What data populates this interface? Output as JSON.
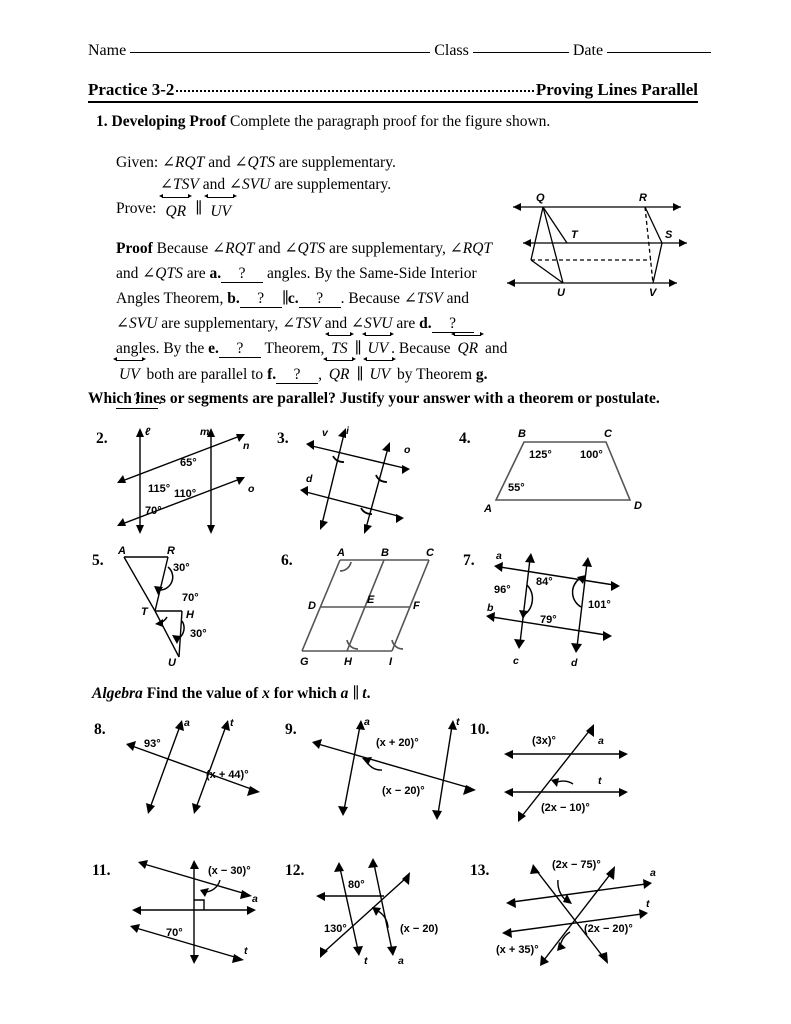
{
  "header": {
    "name_label": "Name",
    "class_label": "Class",
    "date_label": "Date",
    "practice_title": "Practice 3-2",
    "lesson_title": "Proving Lines Parallel"
  },
  "q1": {
    "number": "1.",
    "bold_lead": "Developing Proof",
    "instruction": "Complete the paragraph proof for the figure shown.",
    "given_label": "Given:",
    "given_1_a": "∠RQT",
    "given_1_and": "and",
    "given_1_b": "∠QTS",
    "given_1_tail": "are supplementary.",
    "given_2_a": "∠TSV",
    "given_2_and": "and",
    "given_2_b": "∠SVU",
    "given_2_tail": "are supplementary.",
    "prove_label": "Prove:",
    "prove_line1": "QR",
    "prove_parallel": "∥",
    "prove_line2": "UV",
    "proof_lead": "Proof",
    "p1": "Because",
    "p2": "∠RQT",
    "p3": "and",
    "p4": "∠QTS",
    "p5": "are supplementary,",
    "p6": "∠RQT",
    "p7": "and",
    "p8": "∠QTS",
    "p9": "are",
    "blank_a_label": "a.",
    "blank_a": "?",
    "p10": "angles. By the Same-Side Interior Angles Theorem,",
    "blank_b_label": "b.",
    "blank_b": "?",
    "parallel_sym": "∥",
    "blank_c_label": "c.",
    "blank_c": "?",
    "p11": ". Because",
    "p12": "∠TSV",
    "p13": "and",
    "p14": "∠SVU",
    "p15": "are supplementary,",
    "p16": "∠TSV",
    "p17": "and",
    "p18": "∠SVU",
    "p19": "are",
    "blank_d_label": "d.",
    "blank_d": "?",
    "p20": "angles. By the",
    "blank_e_label": "e.",
    "blank_e": "?",
    "p21": "Theorem,",
    "seg_ts": "TS",
    "seg_uv": "UV",
    "p22": ". Because",
    "seg_qr": "QR",
    "p23": "and",
    "seg_uv2": "UV",
    "p24": "both are parallel to",
    "blank_f_label": "f.",
    "blank_f": "?",
    "p25": ",",
    "seg_qr2": "QR",
    "seg_uv3": "UV",
    "p26": "by Theorem",
    "blank_g_label": "g.",
    "blank_g": "?",
    "p27": ".",
    "figure": {
      "labels": [
        "Q",
        "R",
        "T",
        "S",
        "U",
        "V"
      ]
    }
  },
  "which_instruction": "Which lines or segments are parallel? Justify your answer with a theorem or postulate.",
  "algebra_instruction": {
    "lead": "Algebra",
    "text_1": "Find the value of",
    "var_x": "x",
    "text_2": "for which",
    "line_a": "a",
    "parallel": "∥",
    "line_t": "t",
    "period": "."
  },
  "problems": [
    {
      "number": "2.",
      "line_labels": [
        "ℓ",
        "m",
        "n",
        "o"
      ],
      "angles": [
        "115°",
        "65°",
        "110°",
        "70°"
      ]
    },
    {
      "number": "3.",
      "line_labels": [
        "v",
        "i",
        "o",
        "d"
      ],
      "angles": []
    },
    {
      "number": "4.",
      "vertex_labels": [
        "A",
        "B",
        "C",
        "D"
      ],
      "angles": [
        "125°",
        "100°",
        "55°"
      ]
    },
    {
      "number": "5.",
      "vertex_labels": [
        "A",
        "R",
        "T",
        "H",
        "U"
      ],
      "angles": [
        "30°",
        "70°",
        "30°"
      ]
    },
    {
      "number": "6.",
      "vertex_labels": [
        "A",
        "B",
        "C",
        "D",
        "E",
        "F",
        "G",
        "H",
        "I"
      ],
      "angles": []
    },
    {
      "number": "7.",
      "line_labels": [
        "a",
        "b",
        "c",
        "d"
      ],
      "angles": [
        "96°",
        "84°",
        "101°",
        "79°"
      ]
    },
    {
      "number": "8.",
      "line_labels": [
        "a",
        "t"
      ],
      "angles": [
        "93°",
        "(x + 44)°"
      ]
    },
    {
      "number": "9.",
      "line_labels": [
        "a",
        "t"
      ],
      "angles": [
        "(x + 20)°",
        "(x − 20)°"
      ]
    },
    {
      "number": "10.",
      "line_labels": [
        "a",
        "t"
      ],
      "angles": [
        "(3x)°",
        "(2x − 10)°"
      ]
    },
    {
      "number": "11.",
      "line_labels": [
        "a",
        "t"
      ],
      "angles": [
        "(x − 30)°",
        "70°"
      ]
    },
    {
      "number": "12.",
      "line_labels": [
        "t",
        "a"
      ],
      "angles": [
        "80°",
        "130°",
        "(x − 20)"
      ]
    },
    {
      "number": "13.",
      "line_labels": [
        "a",
        "t"
      ],
      "angles": [
        "(2x − 75)°",
        "(2x − 20)°",
        "(x + 35)°"
      ]
    }
  ]
}
